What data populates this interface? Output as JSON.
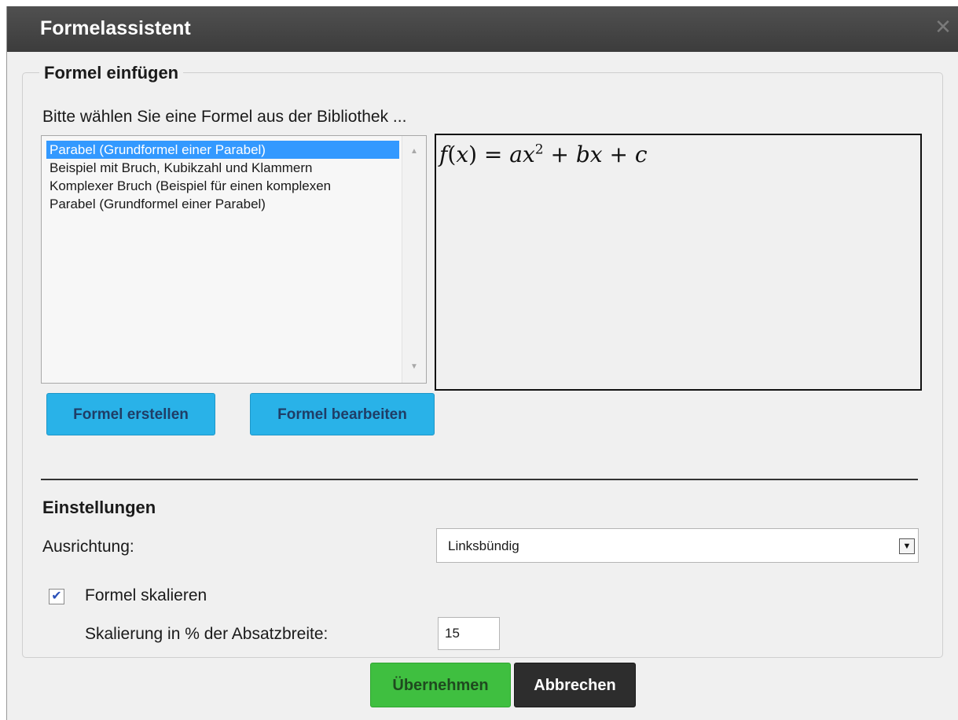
{
  "dialog": {
    "title": "Formelassistent",
    "close_icon": "close-icon"
  },
  "insert_section": {
    "legend": "Formel einfügen",
    "hint": "Bitte wählen Sie eine Formel aus der Bibliothek ...",
    "formula_list": [
      {
        "label": "Parabel (Grundformel einer Parabel)",
        "selected": true
      },
      {
        "label": "Beispiel mit Bruch, Kubikzahl und Klammern",
        "selected": false
      },
      {
        "label": "Komplexer Bruch (Beispiel für einen komplexen",
        "selected": false
      },
      {
        "label": "Parabel (Grundformel einer Parabel)",
        "selected": false
      }
    ],
    "preview": {
      "func": "f",
      "arg": "x",
      "rhs_1": "ax",
      "exponent": "2",
      "rhs_2": "bx",
      "rhs_3": "c"
    },
    "create_button": "Formel erstellen",
    "edit_button": "Formel bearbeiten"
  },
  "settings": {
    "title": "Einstellungen",
    "alignment_label": "Ausrichtung:",
    "alignment_value": "Linksbündig",
    "scale_checkbox_label": "Formel skalieren",
    "scale_checked": true,
    "scale_percent_label": "Skalierung in % der Absatzbreite:",
    "scale_percent_value": "15"
  },
  "footer": {
    "apply_button": "Übernehmen",
    "cancel_button": "Abbrechen"
  },
  "colors": {
    "titlebar": "#474747",
    "selection": "#3399ff",
    "blue_button": "#29b2e8",
    "apply_button": "#3fbf40",
    "cancel_button": "#2d2d2d"
  }
}
